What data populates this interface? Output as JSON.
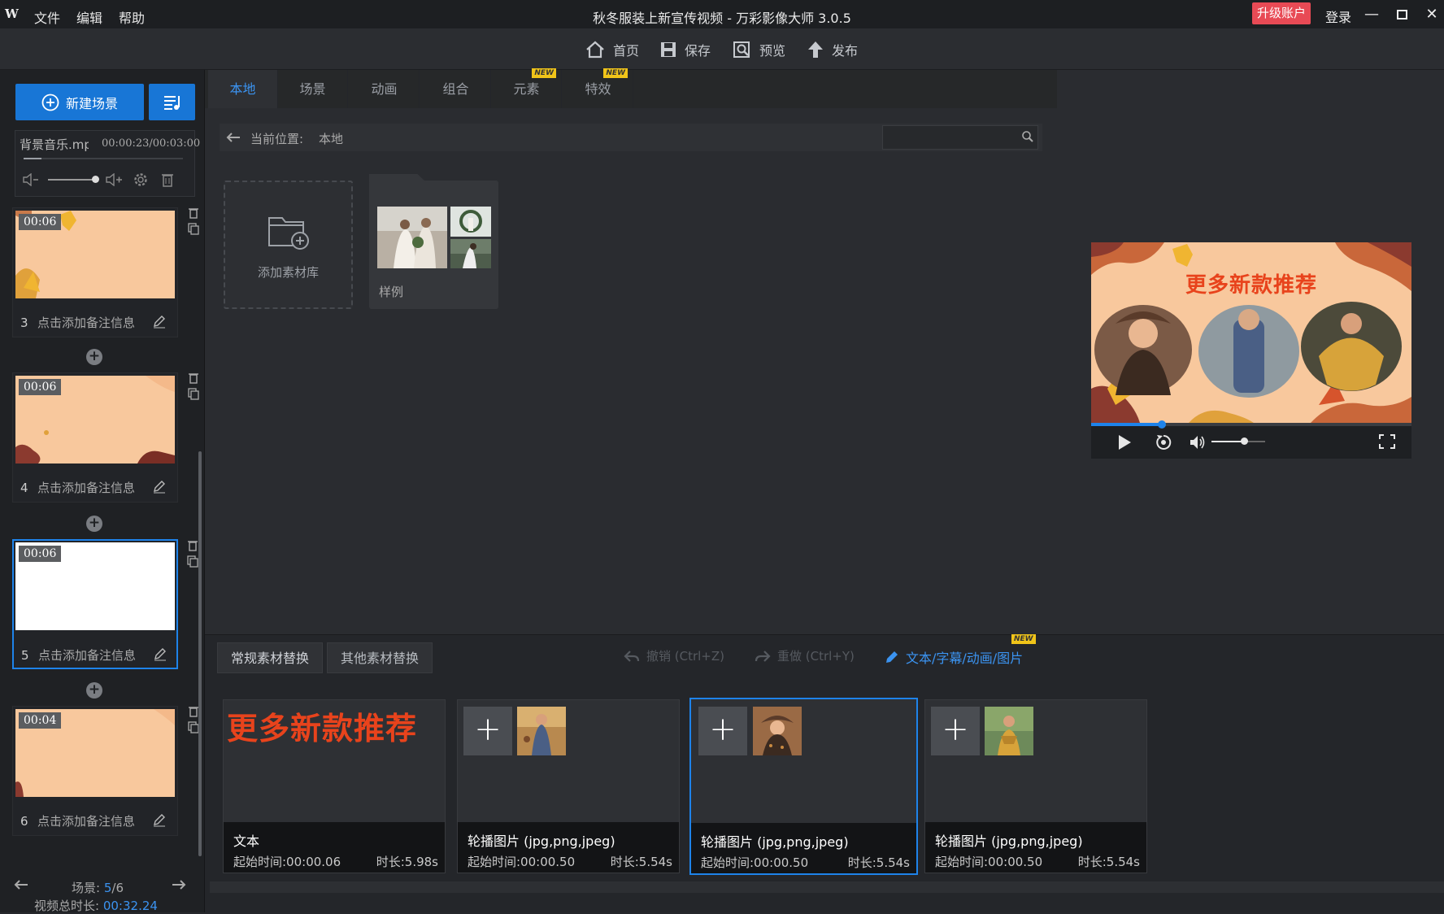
{
  "app": {
    "logo": "W",
    "menu": [
      "文件",
      "编辑",
      "帮助"
    ],
    "title": "秋冬服装上新宣传视频 - 万彩影像大师 3.0.5",
    "upgrade": "升级账户",
    "login": "登录"
  },
  "toolbar": {
    "home": "首页",
    "save": "保存",
    "preview": "预览",
    "publish": "发布"
  },
  "left": {
    "new_scene": "新建场景",
    "music_name": "背景音乐.mp",
    "music_time": "00:00:23/00:03:00",
    "scenes": [
      {
        "duration": "00:06",
        "index": "3",
        "note": "点击添加备注信息"
      },
      {
        "duration": "00:06",
        "index": "4",
        "note": "点击添加备注信息"
      },
      {
        "duration": "00:06",
        "index": "5",
        "note": "点击添加备注信息"
      },
      {
        "duration": "00:04",
        "index": "6",
        "note": "点击添加备注信息"
      }
    ],
    "scene_label": "场景:",
    "scene_current": "5",
    "scene_total": "/6",
    "total_label": "视频总时长:",
    "total_value": "00:32.24"
  },
  "library": {
    "tabs": [
      "本地",
      "场景",
      "动画",
      "组合",
      "元素",
      "特效"
    ],
    "new_badge": "NEW",
    "path_label": "当前位置:",
    "path_value": "本地",
    "search_placeholder": "",
    "add_library": "添加素材库",
    "sample": "样例"
  },
  "preview": {
    "banner": "更多新款推荐",
    "progress": 0.22,
    "volume": 0.6
  },
  "bottom": {
    "tabs": [
      "常规素材替换",
      "其他素材替换"
    ],
    "undo": "撤销 (Ctrl+Z)",
    "redo": "重做 (Ctrl+Y)",
    "text_link": "文本/字幕/动画/图片",
    "new_badge": "NEW",
    "cards": [
      {
        "title": "文本",
        "start": "起始时间:00:00.06",
        "duration": "时长:5.98s",
        "banner": "更多新款推荐"
      },
      {
        "title": "轮播图片 (jpg,png,jpeg)",
        "start": "起始时间:00:00.50",
        "duration": "时长:5.54s"
      },
      {
        "title": "轮播图片 (jpg,png,jpeg)",
        "start": "起始时间:00:00.50",
        "duration": "时长:5.54s"
      },
      {
        "title": "轮播图片 (jpg,png,jpeg)",
        "start": "起始时间:00:00.50",
        "duration": "时长:5.54s"
      }
    ]
  },
  "colors": {
    "accent": "#1876d6",
    "selection": "#1e83ea",
    "upgrade": "#e84a55",
    "banner_text": "#e8431c",
    "scene_bg": "#f8c89d"
  }
}
